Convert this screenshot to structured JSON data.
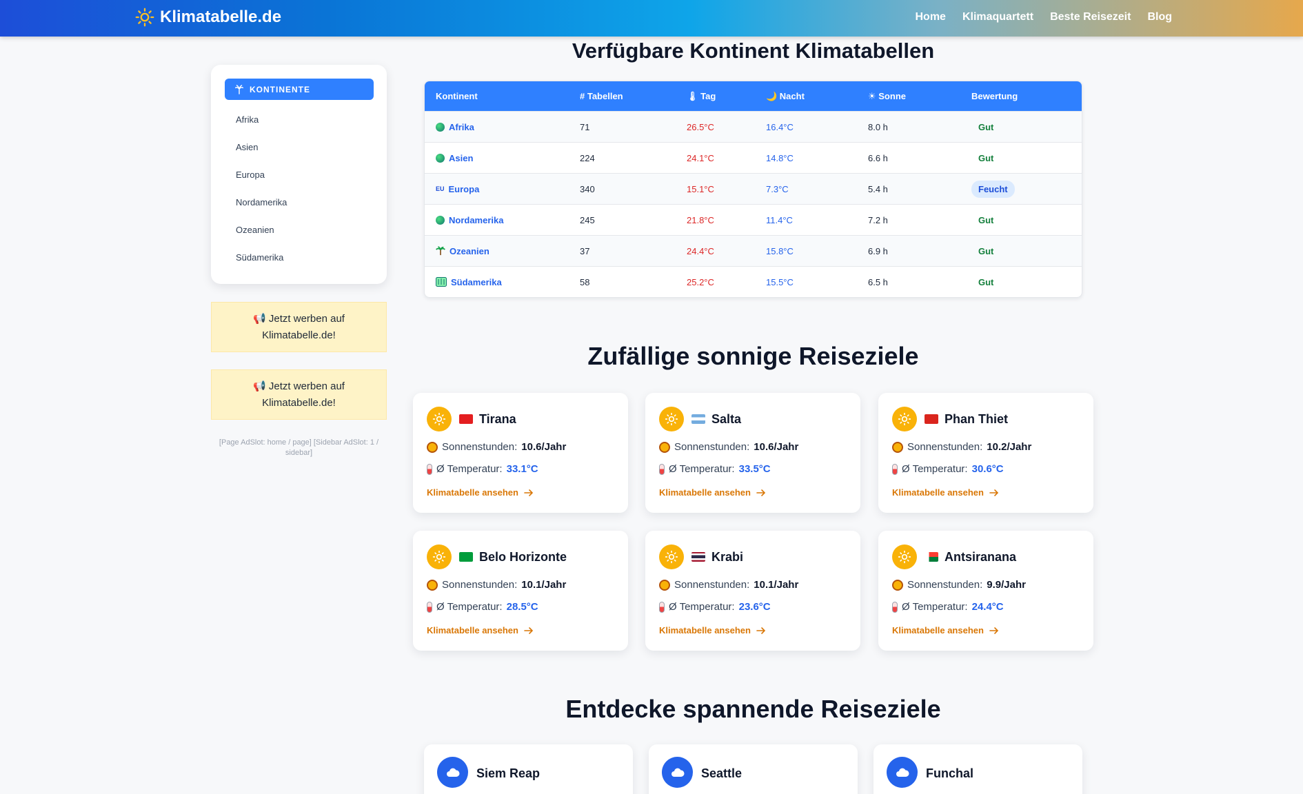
{
  "header": {
    "brand": "Klimatabelle.de",
    "nav": [
      "Home",
      "Klimaquartett",
      "Beste Reisezeit",
      "Blog"
    ]
  },
  "sidebar": {
    "heading": "KONTINENTE",
    "items": [
      "Afrika",
      "Asien",
      "Europa",
      "Nordamerika",
      "Ozeanien",
      "Südamerika"
    ],
    "ad_text": "📢 Jetzt werben auf Klimatabelle.de!",
    "ad_note": "[Page AdSlot: home / page] [Sidebar AdSlot: 1 / sidebar]"
  },
  "continents": {
    "title": "Verfügbare Kontinent Klimatabellen",
    "columns": [
      "Kontinent",
      "# Tabellen",
      "🌡 Tag",
      "🌙 Nacht",
      "☀ Sonne",
      "Bewertung"
    ],
    "rows": [
      {
        "icon": "globe-africa",
        "name": "Afrika",
        "tables": "71",
        "day": "26.5°C",
        "night": "16.4°C",
        "sun": "8.0 h",
        "rating": "Gut"
      },
      {
        "icon": "globe-asia",
        "name": "Asien",
        "tables": "224",
        "day": "24.1°C",
        "night": "14.8°C",
        "sun": "6.6 h",
        "rating": "Gut"
      },
      {
        "icon": "eu",
        "name": "Europa",
        "tables": "340",
        "day": "15.1°C",
        "night": "7.3°C",
        "sun": "5.4 h",
        "rating": "Feucht"
      },
      {
        "icon": "globe-americas",
        "name": "Nordamerika",
        "tables": "245",
        "day": "21.8°C",
        "night": "11.4°C",
        "sun": "7.2 h",
        "rating": "Gut"
      },
      {
        "icon": "palm-tree",
        "name": "Ozeanien",
        "tables": "37",
        "day": "24.4°C",
        "night": "15.8°C",
        "sun": "6.9 h",
        "rating": "Gut"
      },
      {
        "icon": "map",
        "name": "Südamerika",
        "tables": "58",
        "day": "25.2°C",
        "night": "15.5°C",
        "sun": "6.5 h",
        "rating": "Gut"
      }
    ]
  },
  "sunny": {
    "title": "Zufällige sonnige Reiseziele",
    "label_sun": "Sonnenstunden:",
    "label_temp": "Ø Temperatur:",
    "link": "Klimatabelle ansehen",
    "cards": [
      {
        "flag": "flag-albania",
        "name": "Tirana",
        "sun": "10.6/Jahr",
        "temp": "33.1°C"
      },
      {
        "flag": "flag-argentina",
        "name": "Salta",
        "sun": "10.6/Jahr",
        "temp": "33.5°C"
      },
      {
        "flag": "flag-vietnam",
        "name": "Phan Thiet",
        "sun": "10.2/Jahr",
        "temp": "30.6°C"
      },
      {
        "flag": "flag-brazil",
        "name": "Belo Horizonte",
        "sun": "10.1/Jahr",
        "temp": "28.5°C"
      },
      {
        "flag": "flag-thailand",
        "name": "Krabi",
        "sun": "10.1/Jahr",
        "temp": "23.6°C"
      },
      {
        "flag": "flag-madagascar",
        "name": "Antsiranana",
        "sun": "9.9/Jahr",
        "temp": "24.4°C"
      }
    ]
  },
  "discover": {
    "title": "Entdecke spannende Reiseziele",
    "cards": [
      "Siem Reap",
      "Seattle",
      "Funchal"
    ]
  },
  "colors": {
    "accent": "#2f80ff",
    "sun": "#f9b208",
    "link_orange": "#d97706",
    "day_red": "#dc2626",
    "night_blue": "#2563eb"
  }
}
